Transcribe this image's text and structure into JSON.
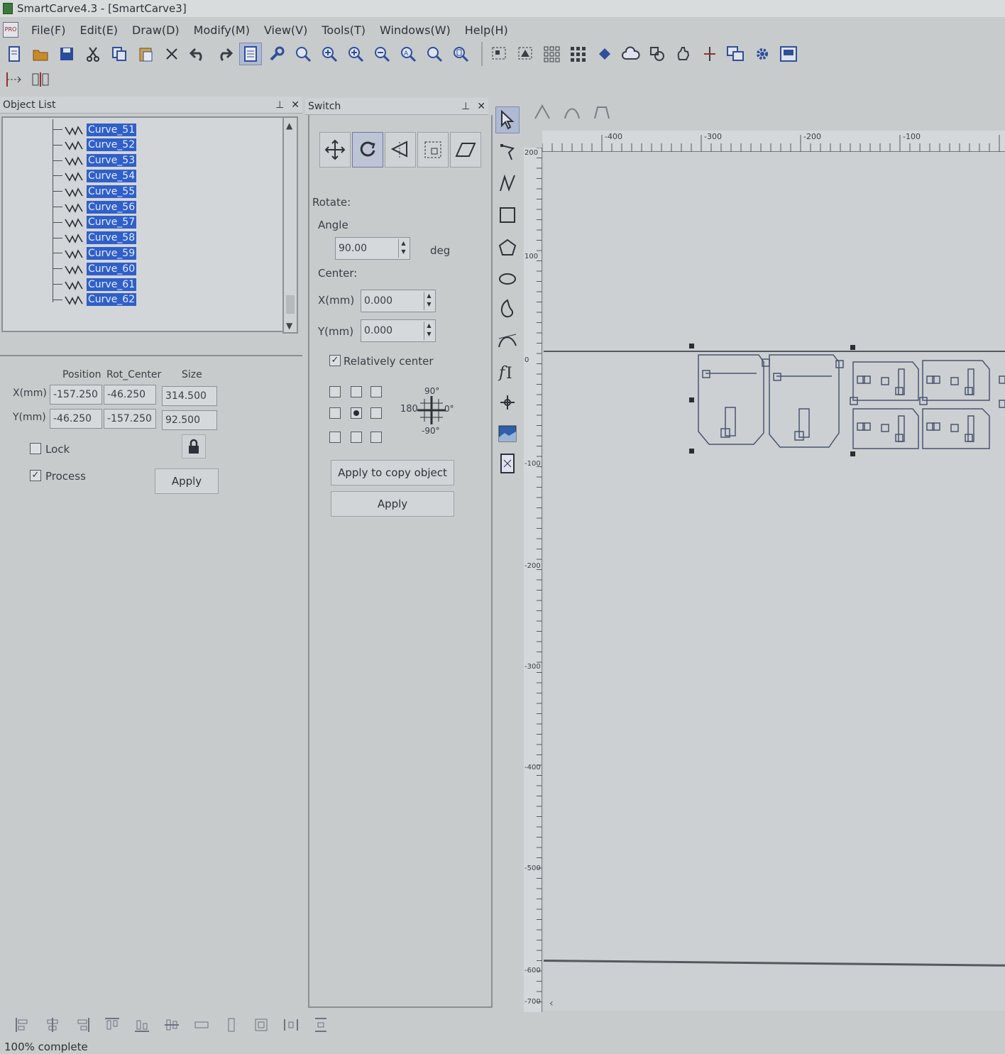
{
  "window": {
    "title": "SmartCarve4.3 - [SmartCarve3]"
  },
  "menu": [
    "File(F)",
    "Edit(E)",
    "Draw(D)",
    "Modify(M)",
    "View(V)",
    "Tools(T)",
    "Windows(W)",
    "Help(H)"
  ],
  "menu_doc_icon": "PRO",
  "object_list": {
    "title": "Object List",
    "items": [
      "Curve_51",
      "Curve_52",
      "Curve_53",
      "Curve_54",
      "Curve_55",
      "Curve_56",
      "Curve_57",
      "Curve_58",
      "Curve_59",
      "Curve_60",
      "Curve_61",
      "Curve_62"
    ]
  },
  "properties": {
    "col_position": "Position",
    "col_rot_center": "Rot_Center",
    "col_size": "Size",
    "x_label": "X(mm)",
    "y_label": "Y(mm)",
    "x_position": "-157.250",
    "x_rot_center": "-46.250",
    "x_size": "314.500",
    "y_position": "-46.250",
    "y_rot_center": "-157.250",
    "y_size": "92.500",
    "lock_label": "Lock",
    "lock_checked": false,
    "process_label": "Process",
    "process_checked": true,
    "apply_label": "Apply"
  },
  "switch_panel": {
    "title": "Switch",
    "section": "Rotate:",
    "angle_label": "Angle",
    "angle_value": "90.00",
    "angle_unit": "deg",
    "center_label": "Center:",
    "x_label": "X(mm)",
    "x_value": "0.000",
    "y_label": "Y(mm)",
    "y_value": "0.000",
    "relative_label": "Relatively center",
    "relative_checked": true,
    "dial_90": "90°",
    "dial_180": "180",
    "dial_0": "0°",
    "dial_m90": "-90°",
    "apply_copy_label": "Apply to copy object",
    "apply_label": "Apply"
  },
  "rulers": {
    "h": [
      "-400",
      "-300",
      "-200",
      "-100"
    ],
    "v": [
      "200",
      "100",
      "0",
      "-100",
      "-200",
      "-300",
      "-400",
      "-500",
      "-600",
      "-700"
    ]
  },
  "status": "100% complete",
  "colors": {
    "selection": "#2f5fc9",
    "active_tool": "#aeb9d4"
  }
}
